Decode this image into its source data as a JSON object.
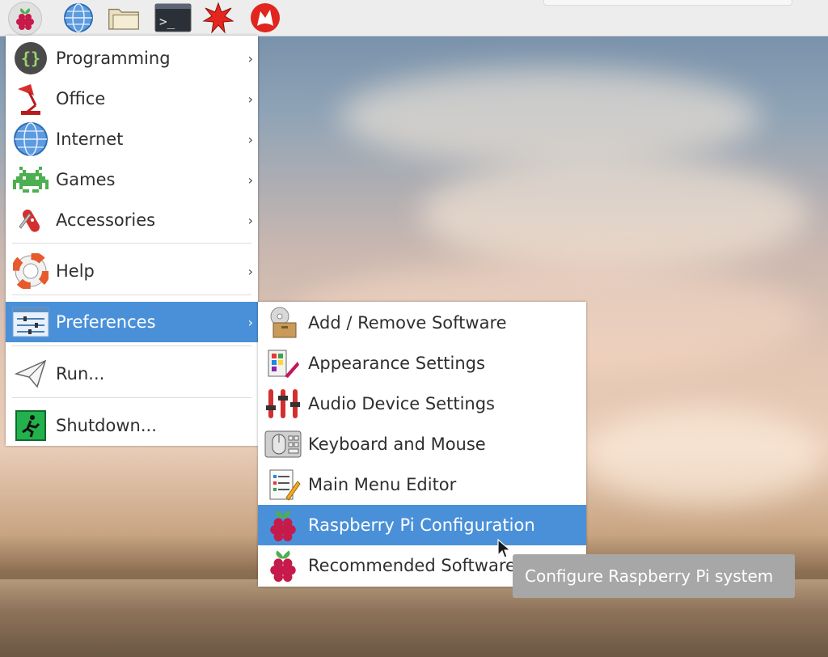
{
  "taskbar": {
    "icons": [
      "raspberry-icon",
      "globe-icon",
      "folder-icon",
      "terminal-icon",
      "starburst-icon",
      "wolfram-icon"
    ]
  },
  "main_menu": {
    "items": [
      {
        "label": "Programming",
        "icon": "braces-icon",
        "arrow": "›"
      },
      {
        "label": "Office",
        "icon": "lamp-icon",
        "arrow": "›"
      },
      {
        "label": "Internet",
        "icon": "globe-icon",
        "arrow": "›"
      },
      {
        "label": "Games",
        "icon": "space-invader-icon",
        "arrow": "›"
      },
      {
        "label": "Accessories",
        "icon": "knife-icon",
        "arrow": "›"
      },
      {
        "label": "Help",
        "icon": "lifebuoy-icon",
        "arrow": "›"
      },
      {
        "label": "Preferences",
        "icon": "sliders-icon",
        "arrow": "›"
      },
      {
        "label": "Run...",
        "icon": "paper-plane-icon"
      },
      {
        "label": "Shutdown...",
        "icon": "exit-icon"
      }
    ]
  },
  "sub_menu": {
    "items": [
      {
        "label": "Add / Remove Software",
        "icon": "package-icon"
      },
      {
        "label": "Appearance Settings",
        "icon": "palette-icon"
      },
      {
        "label": "Audio Device Settings",
        "icon": "mixer-icon"
      },
      {
        "label": "Keyboard and Mouse",
        "icon": "keyboard-mouse-icon"
      },
      {
        "label": "Main Menu Editor",
        "icon": "menu-editor-icon"
      },
      {
        "label": "Raspberry Pi Configuration",
        "icon": "raspberry-icon"
      },
      {
        "label": "Recommended Software",
        "icon": "raspberry-icon"
      }
    ]
  },
  "tooltip": {
    "text": "Configure Raspberry Pi system"
  },
  "colors": {
    "selection": "#4a90d9",
    "tooltip": "#a7a7a7"
  }
}
